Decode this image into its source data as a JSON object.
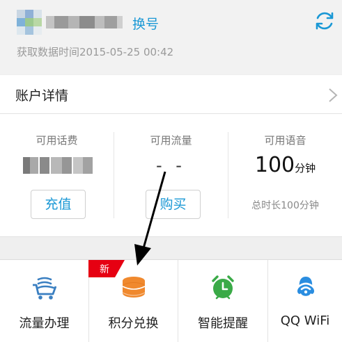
{
  "header": {
    "switch_label": "换号",
    "fetch_time": "获取数据时间2015-05-25  00:42",
    "refresh_icon": "refresh-icon",
    "accent_color": "#1a98d5"
  },
  "account": {
    "title": "账户详情",
    "chevron_icon": "chevron-right-icon"
  },
  "balances": {
    "balance": {
      "label": "可用话费",
      "button": "充值"
    },
    "data": {
      "label": "可用流量",
      "value": "- -",
      "button": "购买"
    },
    "voice": {
      "label": "可用语音",
      "value": "100",
      "unit": "分钟",
      "note": "总时长100分钟"
    }
  },
  "tiles": [
    {
      "label": "流量办理",
      "icon": "cart-icon"
    },
    {
      "label": "积分兑换",
      "icon": "coins-icon",
      "badge": "新"
    },
    {
      "label": "智能提醒",
      "icon": "alarm-clock-icon"
    },
    {
      "label": "QQ WiFi",
      "icon": "wifi-icon"
    }
  ],
  "colors": {
    "badge_red": "#e60012",
    "coin_orange": "#f0892e",
    "clock_green": "#3aaa47"
  }
}
